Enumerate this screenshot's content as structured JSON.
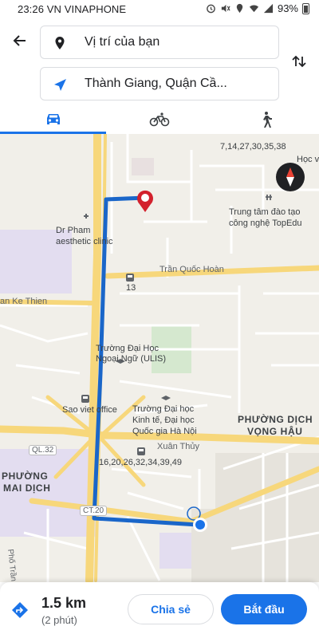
{
  "status_bar": {
    "time_carrier": "23:26 VN VINAPHONE",
    "battery": "93%"
  },
  "directions": {
    "origin": "Vị trí của bạn",
    "destination": "Thành Giang, Quận Cầ..."
  },
  "modes": [
    {
      "name": "drive",
      "icon": "car-icon",
      "selected": true
    },
    {
      "name": "bike",
      "icon": "bicycle-icon",
      "selected": false
    },
    {
      "name": "walk",
      "icon": "walking-icon",
      "selected": false
    }
  ],
  "map": {
    "labels": {
      "bus_routes_top": "7,14,27,30,35,38",
      "hoc_v": "Học v",
      "clinic_1": "Dr Pham",
      "clinic_2": "aesthetic clinic",
      "topedu_1": "Trung tâm đào tạo",
      "topedu_2": "công nghệ TopEdu",
      "road_tran_quoc_hoan": "Trần Quốc Hoàn",
      "bus_13": "13",
      "road_ke_thien": "an Ke Thien",
      "ulis_1": "Trường Đại Học",
      "ulis_2": "Ngoại Ngữ (ULIS)",
      "sao_viet": "Sao viet office",
      "econ_1": "Trường Đại học",
      "econ_2": "Kinh tế, Đại học",
      "econ_3": "Quốc gia Hà Nội",
      "ward_dich_1": "PHƯỜNG DỊCH",
      "ward_dich_2": "VỌNG HẬU",
      "road_ql32": "QL.32",
      "road_xuan_thuy": "Xuân Thủy",
      "bus_routes_bottom": "16,20,26,32,34,39,49",
      "ward_mai_1": "PHƯỜNG",
      "ward_mai_2": "MAI DỊCH",
      "road_ct20": "CT.20",
      "road_tran_binh": "Phố Trần Bình"
    },
    "route_color": "#1a66c9",
    "destination_pin_color": "#d3212d"
  },
  "summary": {
    "distance": "1.5 km",
    "duration": "(2 phút)",
    "share_label": "Chia sẻ",
    "start_label": "Bắt đầu"
  },
  "colors": {
    "accent": "#1a73e8"
  }
}
